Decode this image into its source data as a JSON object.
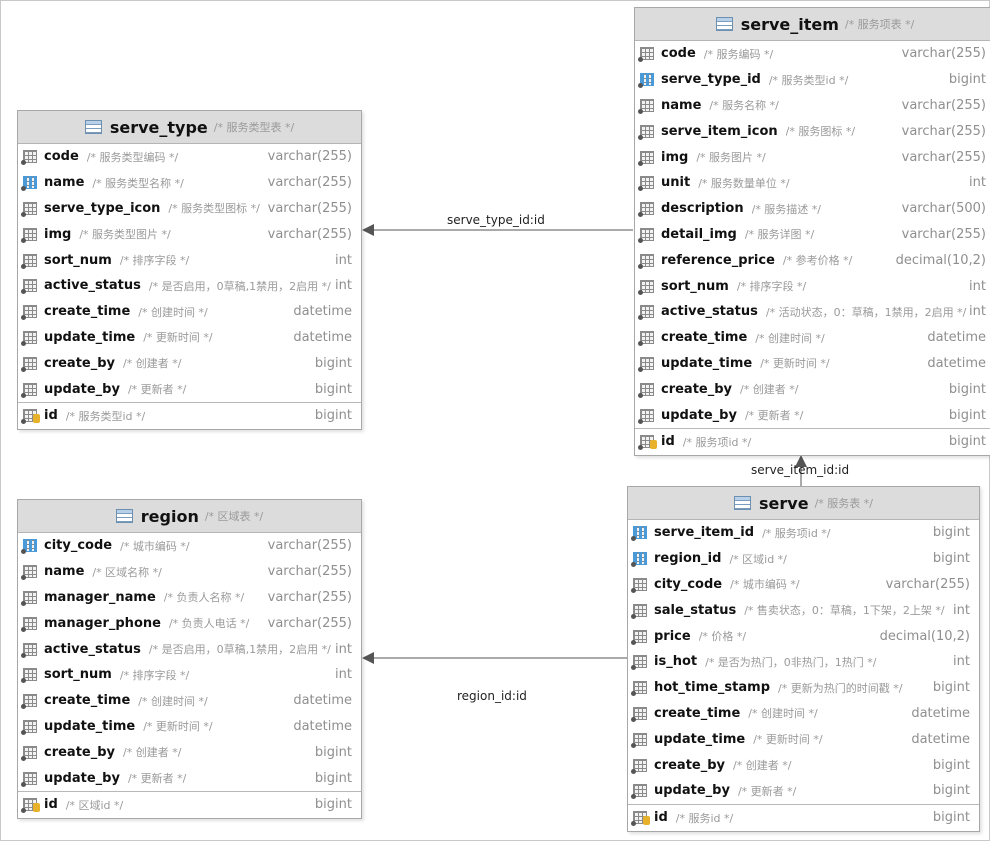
{
  "tables": {
    "serve_type": {
      "name": "serve_type",
      "comment": "/* 服务类型表 */",
      "columns": [
        {
          "name": "code",
          "comment": "/* 服务类型编码 */",
          "type": "varchar(255)",
          "kind": "col"
        },
        {
          "name": "name",
          "comment": "/* 服务类型名称 */",
          "type": "varchar(255)",
          "kind": "fk"
        },
        {
          "name": "serve_type_icon",
          "comment": "/* 服务类型图标 */",
          "type": "varchar(255)",
          "kind": "col"
        },
        {
          "name": "img",
          "comment": "/* 服务类型图片 */",
          "type": "varchar(255)",
          "kind": "col"
        },
        {
          "name": "sort_num",
          "comment": "/* 排序字段 */",
          "type": "int",
          "kind": "col"
        },
        {
          "name": "active_status",
          "comment": "/* 是否启用，0草稿,1禁用，2启用 */",
          "type": "int",
          "kind": "col"
        },
        {
          "name": "create_time",
          "comment": "/* 创建时间 */",
          "type": "datetime",
          "kind": "col"
        },
        {
          "name": "update_time",
          "comment": "/* 更新时间 */",
          "type": "datetime",
          "kind": "col"
        },
        {
          "name": "create_by",
          "comment": "/* 创建者 */",
          "type": "bigint",
          "kind": "col"
        },
        {
          "name": "update_by",
          "comment": "/* 更新者 */",
          "type": "bigint",
          "kind": "col"
        }
      ],
      "pk": {
        "name": "id",
        "comment": "/* 服务类型id */",
        "type": "bigint"
      }
    },
    "region": {
      "name": "region",
      "comment": "/* 区域表 */",
      "columns": [
        {
          "name": "city_code",
          "comment": "/* 城市编码 */",
          "type": "varchar(255)",
          "kind": "fk"
        },
        {
          "name": "name",
          "comment": "/* 区域名称 */",
          "type": "varchar(255)",
          "kind": "col"
        },
        {
          "name": "manager_name",
          "comment": "/* 负责人名称 */",
          "type": "varchar(255)",
          "kind": "col"
        },
        {
          "name": "manager_phone",
          "comment": "/* 负责人电话 */",
          "type": "varchar(255)",
          "kind": "col"
        },
        {
          "name": "active_status",
          "comment": "/* 是否启用，0草稿,1禁用，2启用 */",
          "type": "int",
          "kind": "col"
        },
        {
          "name": "sort_num",
          "comment": "/* 排序字段 */",
          "type": "int",
          "kind": "col"
        },
        {
          "name": "create_time",
          "comment": "/* 创建时间 */",
          "type": "datetime",
          "kind": "col"
        },
        {
          "name": "update_time",
          "comment": "/* 更新时间 */",
          "type": "datetime",
          "kind": "col"
        },
        {
          "name": "create_by",
          "comment": "/* 创建者 */",
          "type": "bigint",
          "kind": "col"
        },
        {
          "name": "update_by",
          "comment": "/* 更新者 */",
          "type": "bigint",
          "kind": "col"
        }
      ],
      "pk": {
        "name": "id",
        "comment": "/* 区域id */",
        "type": "bigint"
      }
    },
    "serve_item": {
      "name": "serve_item",
      "comment": "/* 服务项表 */",
      "columns": [
        {
          "name": "code",
          "comment": "/* 服务编码 */",
          "type": "varchar(255)",
          "kind": "col"
        },
        {
          "name": "serve_type_id",
          "comment": "/* 服务类型id */",
          "type": "bigint",
          "kind": "fk"
        },
        {
          "name": "name",
          "comment": "/* 服务名称 */",
          "type": "varchar(255)",
          "kind": "col"
        },
        {
          "name": "serve_item_icon",
          "comment": "/* 服务图标 */",
          "type": "varchar(255)",
          "kind": "col"
        },
        {
          "name": "img",
          "comment": "/* 服务图片 */",
          "type": "varchar(255)",
          "kind": "col"
        },
        {
          "name": "unit",
          "comment": "/* 服务数量单位 */",
          "type": "int",
          "kind": "col"
        },
        {
          "name": "description",
          "comment": "/* 服务描述 */",
          "type": "varchar(500)",
          "kind": "col"
        },
        {
          "name": "detail_img",
          "comment": "/* 服务详图 */",
          "type": "varchar(255)",
          "kind": "col"
        },
        {
          "name": "reference_price",
          "comment": "/* 参考价格 */",
          "type": "decimal(10,2)",
          "kind": "col"
        },
        {
          "name": "sort_num",
          "comment": "/* 排序字段 */",
          "type": "int",
          "kind": "col"
        },
        {
          "name": "active_status",
          "comment": "/* 活动状态，0：草稿，1禁用，2启用 */",
          "type": "int",
          "kind": "col"
        },
        {
          "name": "create_time",
          "comment": "/* 创建时间 */",
          "type": "datetime",
          "kind": "col"
        },
        {
          "name": "update_time",
          "comment": "/* 更新时间 */",
          "type": "datetime",
          "kind": "col"
        },
        {
          "name": "create_by",
          "comment": "/* 创建者 */",
          "type": "bigint",
          "kind": "col"
        },
        {
          "name": "update_by",
          "comment": "/* 更新者 */",
          "type": "bigint",
          "kind": "col"
        }
      ],
      "pk": {
        "name": "id",
        "comment": "/* 服务项id */",
        "type": "bigint"
      }
    },
    "serve": {
      "name": "serve",
      "comment": "/* 服务表 */",
      "columns": [
        {
          "name": "serve_item_id",
          "comment": "/* 服务项id */",
          "type": "bigint",
          "kind": "fk"
        },
        {
          "name": "region_id",
          "comment": "/* 区域id */",
          "type": "bigint",
          "kind": "fk"
        },
        {
          "name": "city_code",
          "comment": "/* 城市编码 */",
          "type": "varchar(255)",
          "kind": "col"
        },
        {
          "name": "sale_status",
          "comment": "/* 售卖状态，0：草稿，1下架，2上架 */",
          "type": "int",
          "kind": "col"
        },
        {
          "name": "price",
          "comment": "/* 价格 */",
          "type": "decimal(10,2)",
          "kind": "col"
        },
        {
          "name": "is_hot",
          "comment": "/* 是否为热门，0非热门，1热门 */",
          "type": "int",
          "kind": "col"
        },
        {
          "name": "hot_time_stamp",
          "comment": "/* 更新为热门的时间戳 */",
          "type": "bigint",
          "kind": "col"
        },
        {
          "name": "create_time",
          "comment": "/* 创建时间 */",
          "type": "datetime",
          "kind": "col"
        },
        {
          "name": "update_time",
          "comment": "/* 更新时间 */",
          "type": "datetime",
          "kind": "col"
        },
        {
          "name": "create_by",
          "comment": "/* 创建者 */",
          "type": "bigint",
          "kind": "col"
        },
        {
          "name": "update_by",
          "comment": "/* 更新者 */",
          "type": "bigint",
          "kind": "col"
        }
      ],
      "pk": {
        "name": "id",
        "comment": "/* 服务id */",
        "type": "bigint"
      }
    }
  },
  "relations": [
    {
      "label": "serve_type_id:id",
      "from": "serve_item",
      "to": "serve_type"
    },
    {
      "label": "serve_item_id:id",
      "from": "serve",
      "to": "serve_item"
    },
    {
      "label": "region_id:id",
      "from": "serve",
      "to": "region"
    }
  ]
}
